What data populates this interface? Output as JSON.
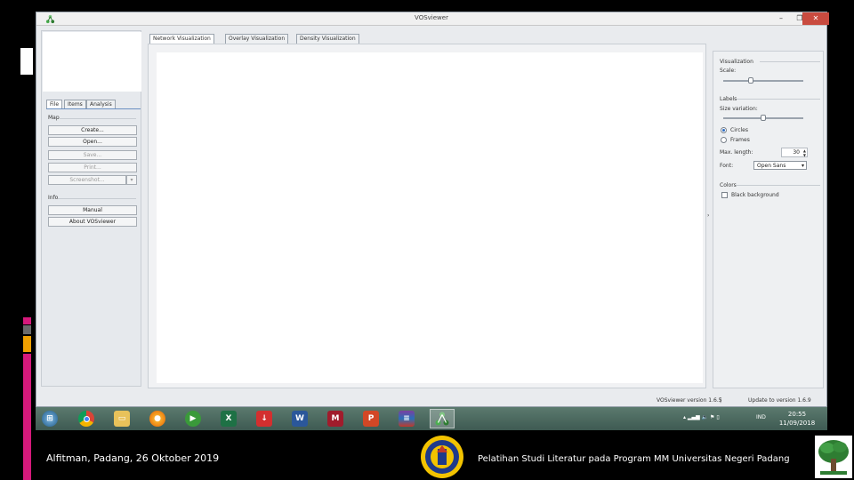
{
  "window": {
    "title": "VOSviewer",
    "minimize_label": "–",
    "maximize_label": "❐",
    "close_label": "✕"
  },
  "left_panel": {
    "tabs": [
      {
        "label": "File"
      },
      {
        "label": "Items"
      },
      {
        "label": "Analysis"
      }
    ],
    "map_section": "Map",
    "map_buttons": [
      "Create...",
      "Open...",
      "Save...",
      "Print...",
      "Screenshot..."
    ],
    "info_section": "Info",
    "info_buttons": [
      "Manual",
      "About VOSviewer"
    ]
  },
  "main_tabs": [
    {
      "label": "Network Visualization"
    },
    {
      "label": "Overlay Visualization"
    },
    {
      "label": "Density Visualization"
    }
  ],
  "right_panel": {
    "visualization_title": "Visualization",
    "scale_label": "Scale:",
    "scale_value": 0.33,
    "labels_title": "Labels",
    "size_variation_label": "Size variation:",
    "size_variation_value": 0.5,
    "radio_circles": "Circles",
    "radio_frames": "Frames",
    "max_length_label": "Max. length:",
    "max_length_value": "30",
    "font_label": "Font:",
    "font_value": "Open Sans",
    "colors_title": "Colors",
    "black_background_label": "Black background"
  },
  "status_bar": {
    "version": "VOSviewer version 1.6.5",
    "separator": "|",
    "update": "Update to version 1.6.9"
  },
  "taskbar": {
    "tray_lang": "IND",
    "clock_time": "20:55",
    "clock_date": "11/09/2018",
    "icons": [
      "start-orb",
      "chrome",
      "file-explorer",
      "firefox",
      "media-player",
      "excel",
      "downloader",
      "word",
      "mendeley",
      "powerpoint",
      "winrar",
      "vosviewer"
    ]
  },
  "footer": {
    "left_text": "Alfitman, Padang, 26 Oktober 2019",
    "right_text": "Pelatihan Studi Literatur pada Program MM Universitas Negeri Padang"
  },
  "colors": {
    "deco_pink": "#d6197b",
    "deco_orange": "#f0a000",
    "deco_grey": "#6a6a6a",
    "accent_blue": "#2b6cc4",
    "close_red": "#c94b3f"
  }
}
